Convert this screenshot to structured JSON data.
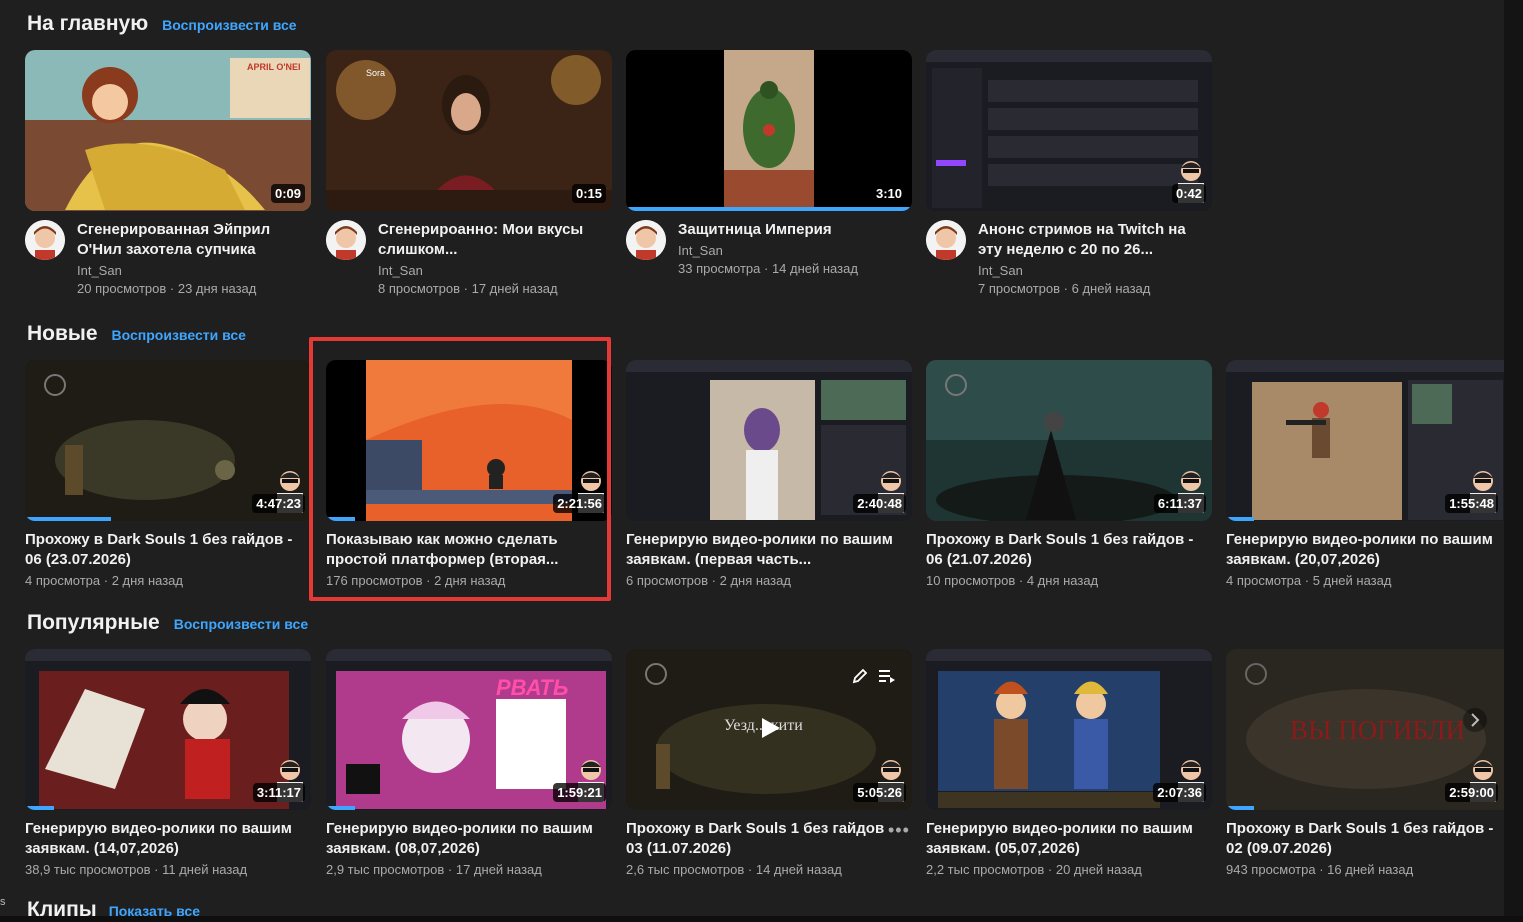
{
  "sections": [
    {
      "title": "На главную",
      "play_all": "Воспроизвести все",
      "videos": [
        {
          "title": "Сгенерированная Эйприл О'Нил захотела супчика",
          "channel": "Int_San",
          "views": "20 просмотров",
          "age": "23 дня назад",
          "duration": "0:09",
          "thumb_text": "APRIL O'NEI",
          "progress_pct": 0
        },
        {
          "title": "Сгенерироанно: Мои вкусы слишком...",
          "channel": "Int_San",
          "views": "8 просмотров",
          "age": "17 дней назад",
          "duration": "0:15",
          "thumb_text": "Sora",
          "progress_pct": 0
        },
        {
          "title": "Защитница Империя",
          "channel": "Int_San",
          "views": "33 просмотра",
          "age": "14 дней назад",
          "duration": "3:10",
          "progress_pct": 100
        },
        {
          "title": "Анонс стримов на Twitch на эту неделю с 20 по 26...",
          "channel": "Int_San",
          "views": "7 просмотров",
          "age": "6 дней назад",
          "duration": "0:42",
          "progress_pct": 0
        }
      ]
    },
    {
      "title": "Новые",
      "play_all": "Воспроизвести все",
      "videos": [
        {
          "title": "Прохожу в Dark Souls 1 без гайдов - 06 (23.07.2026)",
          "views": "4 просмотра",
          "age": "2 дня назад",
          "duration": "4:47:23",
          "progress_pct": 30
        },
        {
          "title": "Показываю как можно сделать простой платформер (вторая...",
          "views": "176 просмотров",
          "age": "2 дня назад",
          "duration": "2:21:56",
          "progress_pct": 10,
          "highlighted": true
        },
        {
          "title": "Генерирую видео-ролики по вашим заявкам. (первая часть...",
          "views": "6 просмотров",
          "age": "2 дня назад",
          "duration": "2:40:48",
          "progress_pct": 0
        },
        {
          "title": "Прохожу в Dark Souls 1 без гайдов - 06 (21.07.2026)",
          "views": "10 просмотров",
          "age": "4 дня назад",
          "duration": "6:11:37",
          "progress_pct": 0
        },
        {
          "title": "Генерирую видео-ролики по вашим заявкам. (20,07,2026)",
          "views": "4 просмотра",
          "age": "5 дней назад",
          "duration": "1:55:48",
          "progress_pct": 10
        }
      ]
    },
    {
      "title": "Популярные",
      "play_all": "Воспроизвести все",
      "videos": [
        {
          "title": "Генерирую видео-ролики по вашим заявкам. (14,07,2026)",
          "views": "38,9 тыс просмотров",
          "age": "11 дней назад",
          "duration": "3:11:17",
          "progress_pct": 10
        },
        {
          "title": "Генерирую видео-ролики по вашим заявкам. (08,07,2026)",
          "views": "2,9 тыс просмотров",
          "age": "17 дней назад",
          "duration": "1:59:21",
          "progress_pct": 10,
          "thumb_text": "РВАТЬ"
        },
        {
          "title": "Прохожу в Dark Souls 1 без гайдов - 03 (11.07.2026)",
          "views": "2,6 тыс просмотров",
          "age": "14 дней назад",
          "duration": "5:05:26",
          "progress_pct": 0,
          "thumb_text": "Уезд... кити"
        },
        {
          "title": "Генерирую видео-ролики по вашим заявкам. (05,07,2026)",
          "views": "2,2 тыс просмотров",
          "age": "20 дней назад",
          "duration": "2:07:36",
          "progress_pct": 0
        },
        {
          "title": "Прохожу в Dark Souls 1 без гайдов - 02 (09.07.2026)",
          "views": "943 просмотра",
          "age": "16 дней назад",
          "duration": "2:59:00",
          "progress_pct": 10,
          "thumb_text": "ВЫ ПОГИБЛИ"
        }
      ]
    }
  ],
  "clips": {
    "title": "Клипы",
    "show_all": "Показать все"
  },
  "colors": {
    "background": "#1f1f1f",
    "accent_link": "#3ea6ff",
    "highlight_box": "#e53935",
    "progress": "#3ea6ff"
  },
  "icons": {
    "more": "more-vert-icon",
    "play": "play-icon",
    "edit": "pencil-icon",
    "queue": "add-to-queue-icon",
    "next": "chevron-right-icon"
  }
}
